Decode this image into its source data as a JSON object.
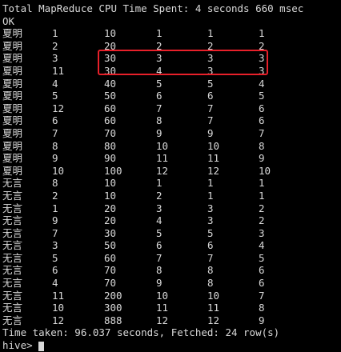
{
  "terminal": {
    "header_line": "Total MapReduce CPU Time Spent: 4 seconds 660 msec",
    "status_line": "OK",
    "rows": [
      [
        "夏明",
        "1",
        "10",
        "1",
        "1",
        "1"
      ],
      [
        "夏明",
        "2",
        "20",
        "2",
        "2",
        "2"
      ],
      [
        "夏明",
        "3",
        "30",
        "3",
        "3",
        "3"
      ],
      [
        "夏明",
        "11",
        "30",
        "4",
        "3",
        "3"
      ],
      [
        "夏明",
        "4",
        "40",
        "5",
        "5",
        "4"
      ],
      [
        "夏明",
        "5",
        "50",
        "6",
        "6",
        "5"
      ],
      [
        "夏明",
        "12",
        "60",
        "7",
        "7",
        "6"
      ],
      [
        "夏明",
        "6",
        "60",
        "8",
        "7",
        "6"
      ],
      [
        "夏明",
        "7",
        "70",
        "9",
        "9",
        "7"
      ],
      [
        "夏明",
        "8",
        "80",
        "10",
        "10",
        "8"
      ],
      [
        "夏明",
        "9",
        "90",
        "11",
        "11",
        "9"
      ],
      [
        "夏明",
        "10",
        "100",
        "12",
        "12",
        "10"
      ],
      [
        "无言",
        "8",
        "10",
        "1",
        "1",
        "1"
      ],
      [
        "无言",
        "2",
        "10",
        "2",
        "1",
        "1"
      ],
      [
        "无言",
        "1",
        "20",
        "3",
        "3",
        "2"
      ],
      [
        "无言",
        "9",
        "20",
        "4",
        "3",
        "2"
      ],
      [
        "无言",
        "7",
        "30",
        "5",
        "5",
        "3"
      ],
      [
        "无言",
        "3",
        "50",
        "6",
        "6",
        "4"
      ],
      [
        "无言",
        "5",
        "60",
        "7",
        "7",
        "5"
      ],
      [
        "无言",
        "6",
        "70",
        "8",
        "8",
        "6"
      ],
      [
        "无言",
        "4",
        "70",
        "9",
        "8",
        "6"
      ],
      [
        "无言",
        "11",
        "200",
        "10",
        "10",
        "7"
      ],
      [
        "无言",
        "10",
        "300",
        "11",
        "11",
        "8"
      ],
      [
        "无言",
        "12",
        "888",
        "12",
        "12",
        "9"
      ]
    ],
    "footer_line": "Time taken: 96.037 seconds, Fetched: 24 row(s)",
    "prompt": "hive>"
  },
  "colors": {
    "background": "#000000",
    "text": "#d9d9d9",
    "highlight_border": "#e8202a"
  }
}
